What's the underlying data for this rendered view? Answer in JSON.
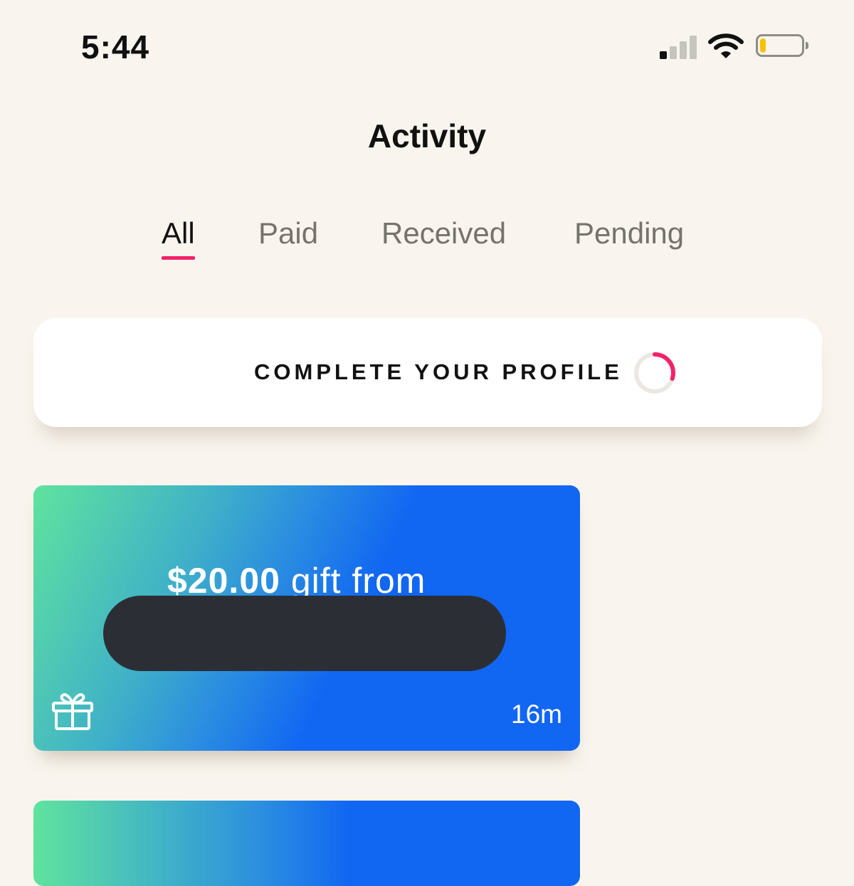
{
  "status_bar": {
    "time": "5:44",
    "signal_bars_active": 1,
    "signal_bars_total": 4,
    "battery_level": 0.15,
    "icons": [
      "cellular-signal-icon",
      "wifi-icon",
      "battery-icon"
    ]
  },
  "header": {
    "title": "Activity"
  },
  "tabs": [
    {
      "label": "All",
      "active": true
    },
    {
      "label": "Paid",
      "active": false
    },
    {
      "label": "Received",
      "active": false
    },
    {
      "label": "Pending",
      "active": false
    }
  ],
  "profile_card": {
    "label": "COMPLETE YOUR PROFILE",
    "progress": 0.3,
    "progress_color": "#f2226a",
    "track_color": "#ece8e1"
  },
  "activities": [
    {
      "amount": "$20.00",
      "description": " gift from",
      "sender": "[redacted]",
      "time": "16m",
      "icon": "gift-icon"
    }
  ],
  "colors": {
    "background": "#f9f5ee",
    "accent": "#f2226a",
    "card_gradient_start": "#5fe39e",
    "card_gradient_end": "#1166f2"
  }
}
